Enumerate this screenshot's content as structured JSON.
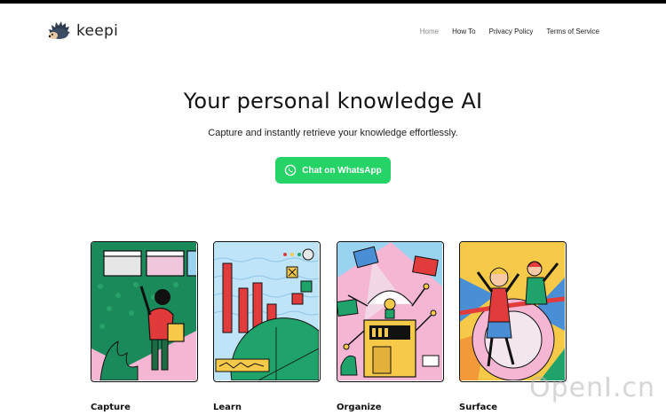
{
  "brand": {
    "name": "keepi"
  },
  "nav": {
    "home": "Home",
    "howto": "How To",
    "privacy": "Privacy Policy",
    "terms": "Terms of Service"
  },
  "hero": {
    "title": "Your personal knowledge AI",
    "subtitle": "Capture and instantly retrieve your knowledge effortlessly.",
    "cta_label": "Chat on WhatsApp"
  },
  "features": [
    {
      "label": "Capture"
    },
    {
      "label": "Learn"
    },
    {
      "label": "Organize"
    },
    {
      "label": "Surface"
    }
  ],
  "watermark": "OpenI.cn",
  "colors": {
    "accent": "#25d366",
    "text": "#111111",
    "nav_active": "#888888"
  }
}
